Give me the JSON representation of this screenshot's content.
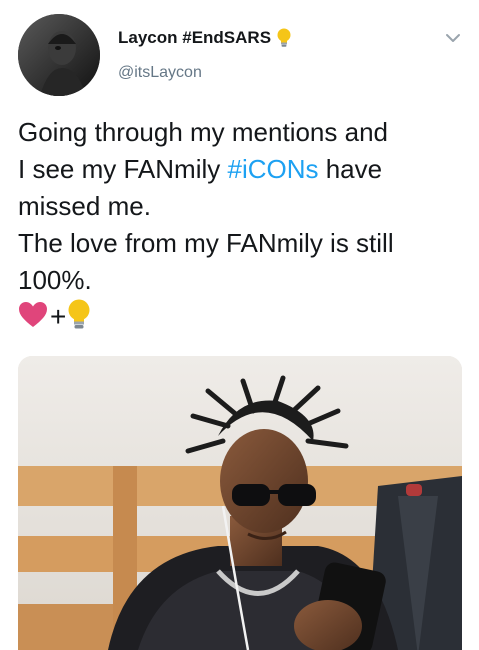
{
  "tweet": {
    "author": {
      "name": "Laycon #EndSARS",
      "handle": "@itsLaycon",
      "badge_icon": "lightbulb-icon"
    },
    "text_lines": [
      "Going through my mentions and",
      "I see  my FANmily ",
      "#iCONs",
      " have",
      "missed me.",
      "The love from my FANmily is still",
      "100%."
    ],
    "emoji_line": {
      "first_icon": "heart-icon",
      "plus": "+",
      "second_icon": "lightbulb-icon"
    },
    "menu_icon": "chevron-down-icon",
    "colors": {
      "text": "#14171a",
      "secondary": "#657786",
      "link": "#1da1f2",
      "heart": "#e0457b",
      "bulb": "#f5c518"
    }
  }
}
